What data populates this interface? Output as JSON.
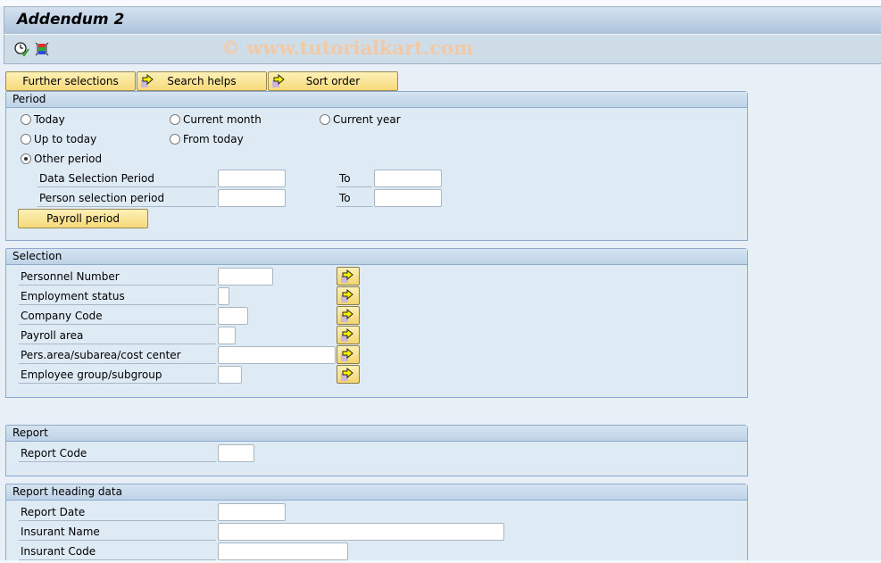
{
  "window": {
    "title": "Addendum 2",
    "watermark": "© www.tutorialkart.com"
  },
  "toolbar": {
    "icons": [
      "execute-clock-icon",
      "variant-layout-icon"
    ]
  },
  "tabs": [
    {
      "label": "Further selections",
      "icon": null
    },
    {
      "label": "Search helps",
      "icon": "arrow-right-icon"
    },
    {
      "label": "Sort order",
      "icon": "arrow-right-icon"
    }
  ],
  "period": {
    "title": "Period",
    "radios": [
      {
        "label": "Today",
        "selected": false
      },
      {
        "label": "Current month",
        "selected": false
      },
      {
        "label": "Current year",
        "selected": false
      },
      {
        "label": "Up to today",
        "selected": false
      },
      {
        "label": "From today",
        "selected": false
      },
      {
        "label": "Other period",
        "selected": true
      }
    ],
    "fields": [
      {
        "label": "Data Selection Period",
        "from": "",
        "to_label": "To",
        "to": ""
      },
      {
        "label": "Person selection period",
        "from": "",
        "to_label": "To",
        "to": ""
      }
    ],
    "payroll_button": "Payroll period"
  },
  "selection": {
    "title": "Selection",
    "fields": [
      {
        "label": "Personnel Number",
        "value": ""
      },
      {
        "label": "Employment status",
        "value": ""
      },
      {
        "label": "Company Code",
        "value": ""
      },
      {
        "label": "Payroll area",
        "value": ""
      },
      {
        "label": "Pers.area/subarea/cost center",
        "value": ""
      },
      {
        "label": "Employee group/subgroup",
        "value": ""
      }
    ]
  },
  "report": {
    "title": "Report",
    "fields": [
      {
        "label": "Report Code",
        "value": ""
      }
    ]
  },
  "heading": {
    "title": "Report heading data",
    "fields": [
      {
        "label": "Report Date",
        "value": ""
      },
      {
        "label": "Insurant Name",
        "value": ""
      },
      {
        "label": "Insurant Code",
        "value": ""
      }
    ]
  }
}
